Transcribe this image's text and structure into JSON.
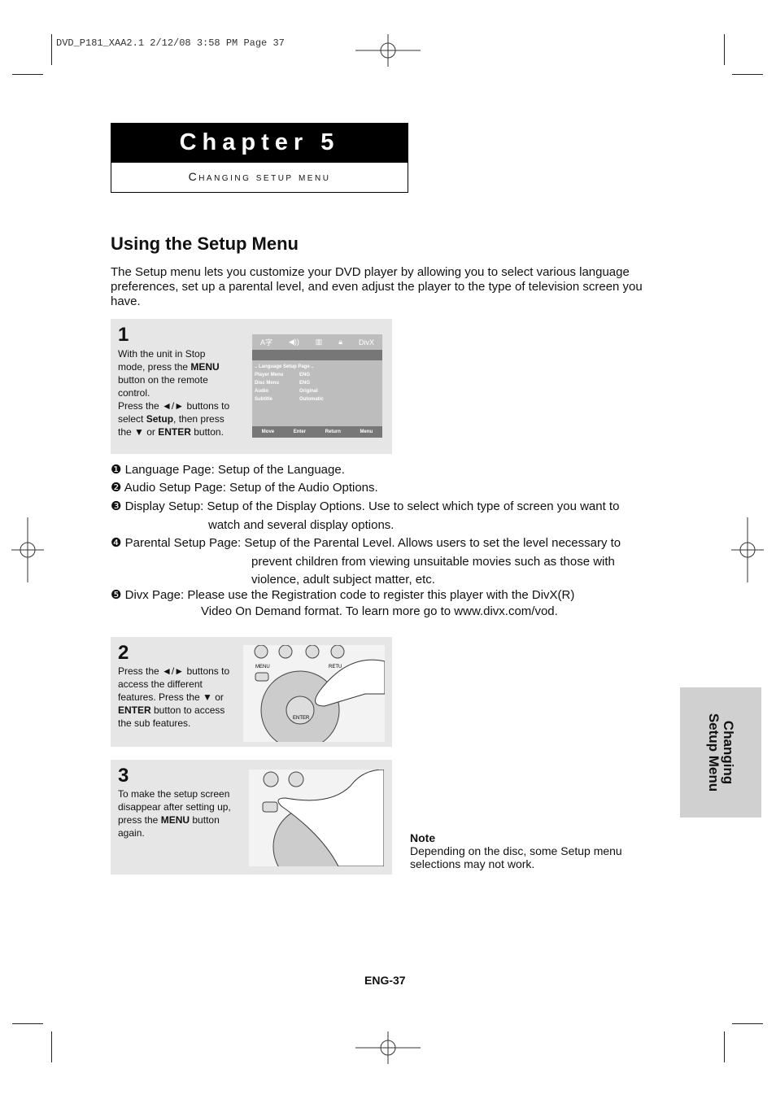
{
  "print_header": "DVD_P181_XAA2.1  2/12/08  3:58 PM  Page 37",
  "chapter": {
    "title": "Chapter 5",
    "subtitle": "Changing setup menu"
  },
  "section_title": "Using the Setup Menu",
  "intro": "The Setup menu lets you customize your DVD player by allowing you to select various language preferences, set up a parental level, and even adjust the player to the type of television screen you have.",
  "steps": [
    {
      "number": "1",
      "parts": [
        "With the unit in Stop mode, press the ",
        "MENU",
        " button on the remote control.\nPress the ◄/► buttons to select ",
        "Setup",
        ", then press the ▼ or ",
        "ENTER",
        " button."
      ]
    },
    {
      "number": "2",
      "parts": [
        "Press the ◄/► buttons to access the different features. Press the ▼ or ",
        "ENTER",
        " button to access the sub features."
      ]
    },
    {
      "number": "3",
      "parts": [
        "To make the setup screen disappear after setting up, press the ",
        "MENU",
        " button again."
      ]
    }
  ],
  "osd": {
    "icons": [
      "language-icon",
      "audio-icon",
      "display-icon",
      "lock-icon",
      "divx-icon"
    ],
    "page_title": ".. Language Setup Page ..",
    "rows": [
      [
        "Player Menu",
        "ENG"
      ],
      [
        "Disc Menu",
        "ENG"
      ],
      [
        "Audio",
        "Original"
      ],
      [
        "Subtitle",
        "Outomatic"
      ]
    ],
    "footer": [
      "Move",
      "Enter",
      "Return",
      "Menu"
    ]
  },
  "remote_labels": {
    "menu": "MENU",
    "return": "RETU",
    "enter": "ENTER"
  },
  "pages": [
    {
      "marker": "❶",
      "text": "Language Page: Setup of the Language."
    },
    {
      "marker": "❷",
      "text": "Audio Setup  Page: Setup of the Audio Options."
    },
    {
      "marker": "❸",
      "text": "Display Setup: Setup of the Display Options. Use to select which type of screen you want to",
      "cont": [
        "watch and several display options."
      ]
    },
    {
      "marker": "❹",
      "text": "Parental Setup  Page: Setup of the Parental Level. Allows users to set the level necessary to",
      "cont": [
        "prevent   children from viewing unsuitable movies such as those with",
        "violence, adult subject matter, etc."
      ]
    },
    {
      "marker": "❺",
      "text": "Divx  Page: Please use the Registration code to register this player with the DivX(R)",
      "cont": [
        "Video On Demand format. To learn more go to www.divx.com/vod."
      ]
    }
  ],
  "note": {
    "title": "Note",
    "text": "Depending on the disc, some Setup menu selections may not work."
  },
  "side_tab": [
    "Changing",
    "Setup Menu"
  ],
  "page_number": "ENG-37"
}
